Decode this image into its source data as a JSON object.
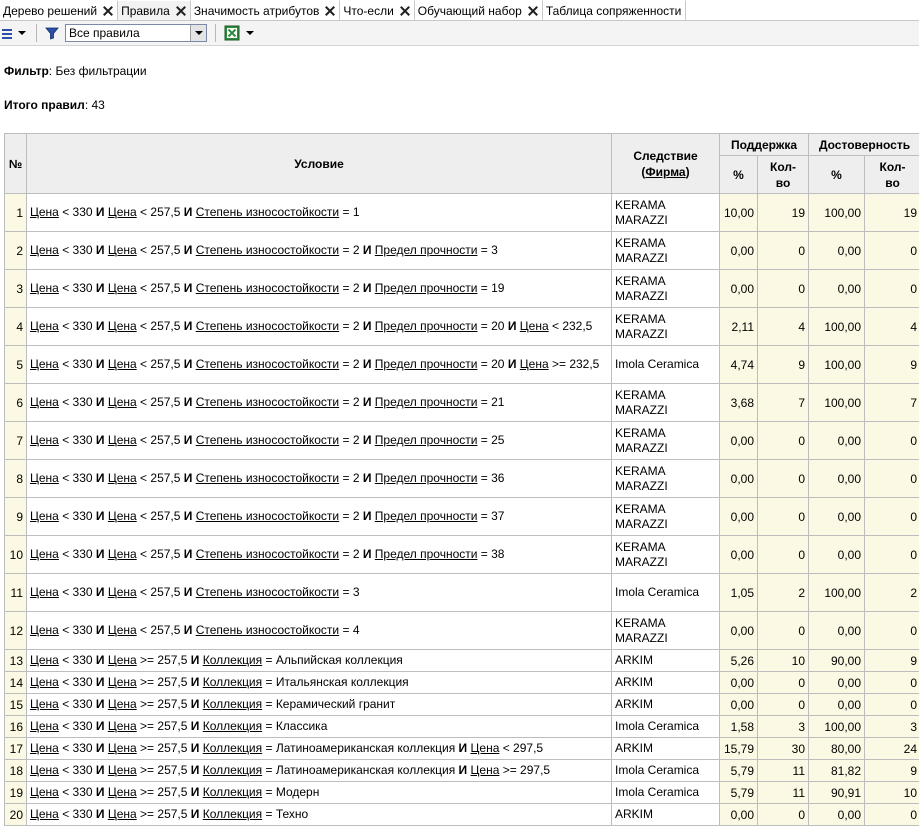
{
  "tabs": [
    {
      "label": "Дерево решений",
      "active": false
    },
    {
      "label": "Правила",
      "active": true
    },
    {
      "label": "Значимость атрибутов",
      "active": false
    },
    {
      "label": "Что-если",
      "active": false
    },
    {
      "label": "Обучающий набор",
      "active": false
    },
    {
      "label": "Таблица сопряженности",
      "active": false
    }
  ],
  "toolbar": {
    "filter_select_value": "Все правила",
    "icons": [
      "list-icon",
      "filter-icon",
      "excel-export-icon"
    ]
  },
  "info": {
    "filter_label": "Фильтр",
    "filter_value": ": Без фильтрации",
    "total_label": "Итого правил",
    "total_value": ": 43"
  },
  "table": {
    "headers": {
      "num": "№",
      "condition": "Условие",
      "consequence_1": "Следствие",
      "consequence_attr": "Фирма",
      "support": "Поддержка",
      "confidence": "Достоверность",
      "percent": "%",
      "count_1": "Кол-",
      "count_2": "во"
    },
    "and_word": "И",
    "rows": [
      {
        "n": "1",
        "cond": [
          [
            "Цена",
            " < 330 "
          ],
          [
            "Цена",
            " < 257,5 "
          ],
          [
            "Степень износостойкости",
            " = 1"
          ]
        ],
        "cons": "KERAMA MARAZZI",
        "sp": "10,00",
        "sc": "19",
        "cp": "100,00",
        "cc": "19"
      },
      {
        "n": "2",
        "cond": [
          [
            "Цена",
            " < 330 "
          ],
          [
            "Цена",
            " < 257,5 "
          ],
          [
            "Степень износостойкости",
            " = 2 "
          ],
          [
            "Предел прочности",
            " = 3"
          ]
        ],
        "cons": "KERAMA MARAZZI",
        "sp": "0,00",
        "sc": "0",
        "cp": "0,00",
        "cc": "0"
      },
      {
        "n": "3",
        "cond": [
          [
            "Цена",
            " < 330 "
          ],
          [
            "Цена",
            " < 257,5 "
          ],
          [
            "Степень износостойкости",
            " = 2 "
          ],
          [
            "Предел прочности",
            " = 19"
          ]
        ],
        "cons": "KERAMA MARAZZI",
        "sp": "0,00",
        "sc": "0",
        "cp": "0,00",
        "cc": "0"
      },
      {
        "n": "4",
        "cond": [
          [
            "Цена",
            " < 330 "
          ],
          [
            "Цена",
            " < 257,5 "
          ],
          [
            "Степень износостойкости",
            " = 2 "
          ],
          [
            "Предел прочности",
            " = 20 "
          ],
          [
            "Цена",
            " < 232,5"
          ]
        ],
        "cons": "KERAMA MARAZZI",
        "sp": "2,11",
        "sc": "4",
        "cp": "100,00",
        "cc": "4"
      },
      {
        "n": "5",
        "cond": [
          [
            "Цена",
            " < 330 "
          ],
          [
            "Цена",
            " < 257,5 "
          ],
          [
            "Степень износостойкости",
            " = 2 "
          ],
          [
            "Предел прочности",
            " = 20 "
          ],
          [
            "Цена",
            " >= 232,5"
          ]
        ],
        "cons": "Imola Ceramica",
        "sp": "4,74",
        "sc": "9",
        "cp": "100,00",
        "cc": "9"
      },
      {
        "n": "6",
        "cond": [
          [
            "Цена",
            " < 330 "
          ],
          [
            "Цена",
            " < 257,5 "
          ],
          [
            "Степень износостойкости",
            " = 2 "
          ],
          [
            "Предел прочности",
            " = 21"
          ]
        ],
        "cons": "KERAMA MARAZZI",
        "sp": "3,68",
        "sc": "7",
        "cp": "100,00",
        "cc": "7"
      },
      {
        "n": "7",
        "cond": [
          [
            "Цена",
            " < 330 "
          ],
          [
            "Цена",
            " < 257,5 "
          ],
          [
            "Степень износостойкости",
            " = 2 "
          ],
          [
            "Предел прочности",
            " = 25"
          ]
        ],
        "cons": "KERAMA MARAZZI",
        "sp": "0,00",
        "sc": "0",
        "cp": "0,00",
        "cc": "0"
      },
      {
        "n": "8",
        "cond": [
          [
            "Цена",
            " < 330 "
          ],
          [
            "Цена",
            " < 257,5 "
          ],
          [
            "Степень износостойкости",
            " = 2 "
          ],
          [
            "Предел прочности",
            " = 36"
          ]
        ],
        "cons": "KERAMA MARAZZI",
        "sp": "0,00",
        "sc": "0",
        "cp": "0,00",
        "cc": "0"
      },
      {
        "n": "9",
        "cond": [
          [
            "Цена",
            " < 330 "
          ],
          [
            "Цена",
            " < 257,5 "
          ],
          [
            "Степень износостойкости",
            " = 2 "
          ],
          [
            "Предел прочности",
            " = 37"
          ]
        ],
        "cons": "KERAMA MARAZZI",
        "sp": "0,00",
        "sc": "0",
        "cp": "0,00",
        "cc": "0"
      },
      {
        "n": "10",
        "cond": [
          [
            "Цена",
            " < 330 "
          ],
          [
            "Цена",
            " < 257,5 "
          ],
          [
            "Степень износостойкости",
            " = 2 "
          ],
          [
            "Предел прочности",
            " = 38"
          ]
        ],
        "cons": "KERAMA MARAZZI",
        "sp": "0,00",
        "sc": "0",
        "cp": "0,00",
        "cc": "0"
      },
      {
        "n": "11",
        "cond": [
          [
            "Цена",
            " < 330 "
          ],
          [
            "Цена",
            " < 257,5 "
          ],
          [
            "Степень износостойкости",
            " = 3"
          ]
        ],
        "cons": "Imola Ceramica",
        "sp": "1,05",
        "sc": "2",
        "cp": "100,00",
        "cc": "2"
      },
      {
        "n": "12",
        "cond": [
          [
            "Цена",
            " < 330 "
          ],
          [
            "Цена",
            " < 257,5 "
          ],
          [
            "Степень износостойкости",
            " = 4"
          ]
        ],
        "cons": "KERAMA MARAZZI",
        "sp": "0,00",
        "sc": "0",
        "cp": "0,00",
        "cc": "0"
      },
      {
        "n": "13",
        "cond": [
          [
            "Цена",
            " < 330 "
          ],
          [
            "Цена",
            " >= 257,5 "
          ],
          [
            "Коллекция",
            " = Альпийская коллекция"
          ]
        ],
        "cons": "ARKIM",
        "sp": "5,26",
        "sc": "10",
        "cp": "90,00",
        "cc": "9"
      },
      {
        "n": "14",
        "cond": [
          [
            "Цена",
            " < 330 "
          ],
          [
            "Цена",
            " >= 257,5 "
          ],
          [
            "Коллекция",
            " = Итальянская коллекция"
          ]
        ],
        "cons": "ARKIM",
        "sp": "0,00",
        "sc": "0",
        "cp": "0,00",
        "cc": "0"
      },
      {
        "n": "15",
        "cond": [
          [
            "Цена",
            " < 330 "
          ],
          [
            "Цена",
            " >= 257,5 "
          ],
          [
            "Коллекция",
            " = Керамический гранит"
          ]
        ],
        "cons": "ARKIM",
        "sp": "0,00",
        "sc": "0",
        "cp": "0,00",
        "cc": "0"
      },
      {
        "n": "16",
        "cond": [
          [
            "Цена",
            " < 330 "
          ],
          [
            "Цена",
            " >= 257,5 "
          ],
          [
            "Коллекция",
            " = Классика"
          ]
        ],
        "cons": "Imola Ceramica",
        "sp": "1,58",
        "sc": "3",
        "cp": "100,00",
        "cc": "3"
      },
      {
        "n": "17",
        "cond": [
          [
            "Цена",
            " < 330 "
          ],
          [
            "Цена",
            " >= 257,5 "
          ],
          [
            "Коллекция",
            " = Латиноамериканская коллекция "
          ],
          [
            "Цена",
            " < 297,5"
          ]
        ],
        "cons": "ARKIM",
        "sp": "15,79",
        "sc": "30",
        "cp": "80,00",
        "cc": "24"
      },
      {
        "n": "18",
        "cond": [
          [
            "Цена",
            " < 330 "
          ],
          [
            "Цена",
            " >= 257,5 "
          ],
          [
            "Коллекция",
            " = Латиноамериканская коллекция "
          ],
          [
            "Цена",
            " >= 297,5"
          ]
        ],
        "cons": "Imola Ceramica",
        "sp": "5,79",
        "sc": "11",
        "cp": "81,82",
        "cc": "9"
      },
      {
        "n": "19",
        "cond": [
          [
            "Цена",
            " < 330 "
          ],
          [
            "Цена",
            " >= 257,5 "
          ],
          [
            "Коллекция",
            " = Модерн"
          ]
        ],
        "cons": "Imola Ceramica",
        "sp": "5,79",
        "sc": "11",
        "cp": "90,91",
        "cc": "10"
      },
      {
        "n": "20",
        "cond": [
          [
            "Цена",
            " < 330 "
          ],
          [
            "Цена",
            " >= 257,5 "
          ],
          [
            "Коллекция",
            " = Техно"
          ]
        ],
        "cons": "ARKIM",
        "sp": "0,00",
        "sc": "0",
        "cp": "0,00",
        "cc": "0"
      }
    ]
  }
}
